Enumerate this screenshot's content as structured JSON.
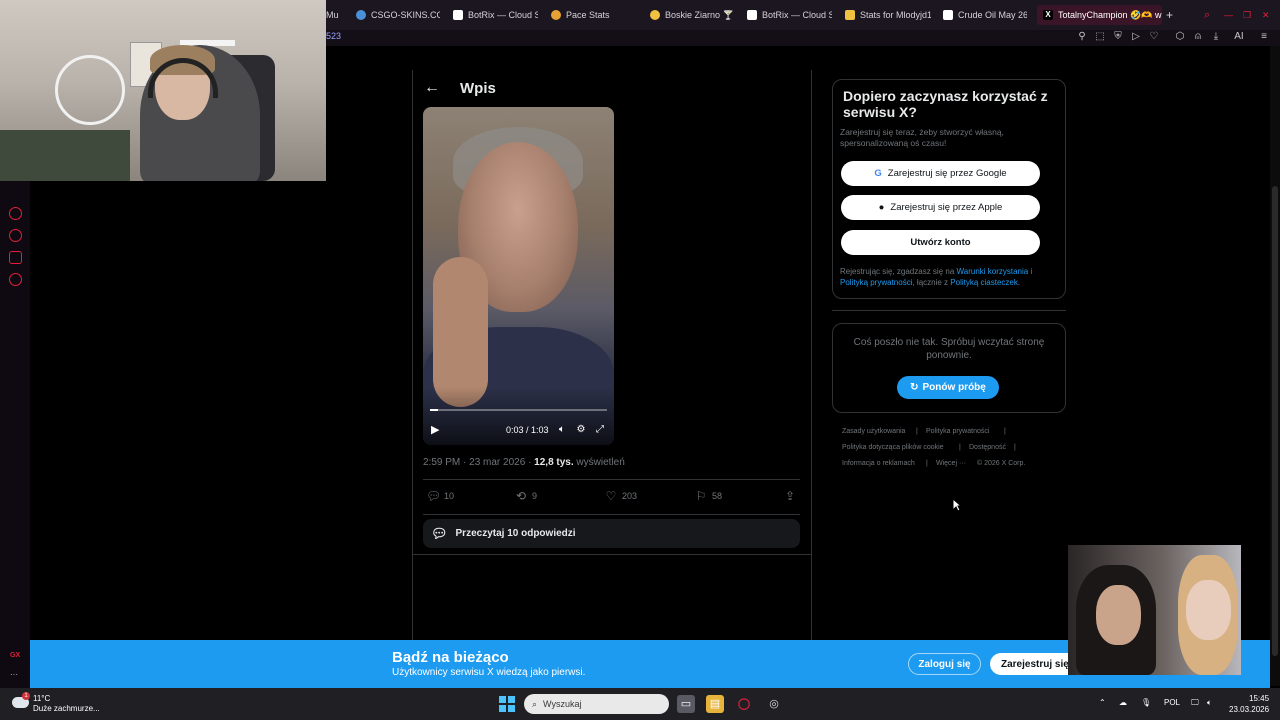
{
  "browser": {
    "tabs": [
      {
        "label": "Mu",
        "icon": "music-icon"
      },
      {
        "label": "CSGO-SKINS.CO",
        "icon": "csgo-icon"
      },
      {
        "label": "BotRix — Cloud St",
        "icon": "botrix-icon"
      },
      {
        "label": "Pace Stats",
        "icon": "pace-icon"
      },
      {
        "label": "Boskie Ziarno 🍸",
        "icon": "coffee-icon"
      },
      {
        "label": "BotRix — Cloud St",
        "icon": "botrix-icon"
      },
      {
        "label": "Stats for Mlodyjd1",
        "icon": "stats-icon"
      },
      {
        "label": "Crude Oil May 26",
        "icon": "chart-icon"
      },
      {
        "label": "TotalnyChampion 🤣🫶 w",
        "icon": "x-icon",
        "active": true
      }
    ],
    "url_fragment": "523",
    "toolbar_ai_label": "AI"
  },
  "post": {
    "back_label": "←",
    "title": "Wpis",
    "video": {
      "time": "0:03 / 1:03",
      "progress": 0.048
    },
    "timestamp": "2:59 PM · 23 mar 2026 · ",
    "views_count": "12,8 tys.",
    "views_label": " wyświetleń",
    "actions": {
      "replies": "10",
      "reposts": "9",
      "likes": "203",
      "bookmarks": "58"
    },
    "read_replies": "Przeczytaj 10 odpowiedzi"
  },
  "signup": {
    "title": "Dopiero zaczynasz korzystać z serwisu X?",
    "subtitle": "Zarejestruj się teraz, żeby stworzyć własną, spersonalizowaną oś czasu!",
    "google_label": "Zarejestruj się przez Google",
    "apple_label": "Zarejestruj się przez Apple",
    "create_label": "Utwórz konto",
    "legal_prefix": "Rejestrując się, zgadzasz się na ",
    "terms_link": "Warunki korzystania",
    "legal_sep": " i ",
    "privacy_link": "Polityką prywatności",
    "legal_mid": ", łącznie z ",
    "cookie_link": "Polityką ciasteczek",
    "legal_end": "."
  },
  "error": {
    "message": "Coś poszło nie tak. Spróbuj wczytać stronę ponownie.",
    "retry_label": "Ponów próbę"
  },
  "footer": {
    "links": [
      "Zasady użytkowania",
      "Polityka prywatności",
      "Polityka dotycząca plików cookie",
      "Dostępność",
      "Informacja o reklamach",
      "Więcej ···",
      "© 2026 X Corp."
    ]
  },
  "banner": {
    "title": "Bądź na bieżąco",
    "subtitle": "Użytkownicy serwisu X wiedzą jako pierwsi.",
    "login_label": "Zaloguj się",
    "register_label": "Zarejestruj się"
  },
  "taskbar": {
    "weather_temp": "11°C",
    "weather_desc": "Duże zachmurze...",
    "weather_badge": "1",
    "search_placeholder": "Wyszukaj",
    "lang": "POL",
    "time": "15:45",
    "date": "23.03.2026"
  },
  "sidebar": {
    "gx_label": "GX",
    "more_label": "···"
  },
  "colors": {
    "accent": "#1d9bf0",
    "opera_red": "#e0203d",
    "background": "#000000",
    "muted": "#71767b"
  }
}
